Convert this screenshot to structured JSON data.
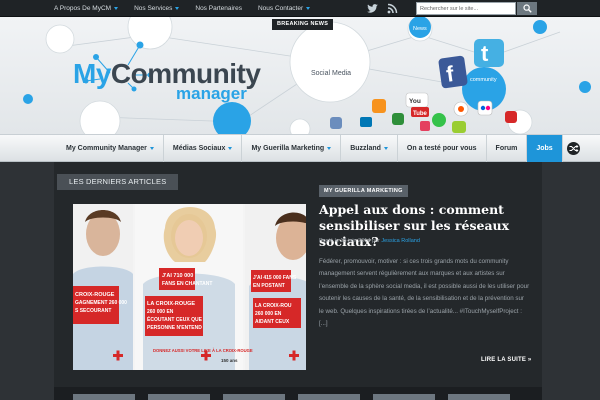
{
  "topbar": {
    "nav": [
      {
        "label": "A Propos De MyCM",
        "dropdown": true
      },
      {
        "label": "Nos Services",
        "dropdown": true
      },
      {
        "label": "Nos Partenaires",
        "dropdown": false
      },
      {
        "label": "Nous Contacter",
        "dropdown": true
      }
    ],
    "social": [
      "twitter-icon",
      "rss-icon"
    ],
    "search": {
      "placeholder": "Rechercher sur le site..."
    }
  },
  "header": {
    "breaking_news": "BREAKING NEWS",
    "logo": {
      "line1": "MyCommunity",
      "line2": "manager"
    },
    "bubbles": [
      "Social Media",
      "News",
      "community"
    ]
  },
  "mainnav": {
    "items": [
      {
        "label": "My Community Manager",
        "dropdown": true,
        "active": false
      },
      {
        "label": "Médias Sociaux",
        "dropdown": true,
        "active": false
      },
      {
        "label": "My Guerilla Marketing",
        "dropdown": true,
        "active": false
      },
      {
        "label": "Buzzland",
        "dropdown": true,
        "active": false
      },
      {
        "label": "On a testé pour vous",
        "dropdown": false,
        "active": false
      },
      {
        "label": "Forum",
        "dropdown": false,
        "active": false
      },
      {
        "label": "Jobs",
        "dropdown": false,
        "active": true
      }
    ]
  },
  "content": {
    "section_label": "LES DERNIERS ARTICLES",
    "post": {
      "category": "MY GUERILLA MARKETING",
      "title": "Appel aux dons : comment sensibiliser sur les réseaux sociaux?",
      "meta_prefix": "Posté le 18 juin 2014 par",
      "author": "Jessica Rolland",
      "excerpt": "Fédérer, promouvoir, motiver : si ces trois grands mots du community management servent régulièrement aux marques et aux artistes sur l’ensemble de la sphère social media, il est possible aussi de les utiliser pour soutenir les causes de la santé, de la sensibilisation et de la prévention sur le web. Quelques inspirations tirées de l’actualité... #ITouchMyselfProject : [...]",
      "read_more": "LIRE LA SUITE »",
      "image": {
        "panels": [
          {
            "lines": [
              "CROIX-ROUGE",
              "GAGNEMENT 260 000",
              "S SECOURANT"
            ]
          },
          {
            "lines": [
              "J'AI 710 000",
              "FANS EN CHANTANT"
            ],
            "lines2": [
              "LA CROIX-ROUGE",
              "260 000 EN",
              "ÉCOUTANT CEUX QUE",
              "PERSONNE N'ENTEND"
            ]
          },
          {
            "lines": [
              "J'AI 415 000 FANS",
              "EN POSTANT"
            ],
            "lines2": [
              "LA CROIX-ROU",
              "260 000 EN",
              "AIDANT CEUX"
            ]
          }
        ],
        "cta": "DONNEZ AUSSI VOTRE LIKE À LA CROIX-ROUGE",
        "badge": "150 ans"
      }
    }
  },
  "colors": {
    "accent": "#1e95d9",
    "dark": "#1f2326",
    "content_bg": "#24282b",
    "red": "#d62828"
  }
}
